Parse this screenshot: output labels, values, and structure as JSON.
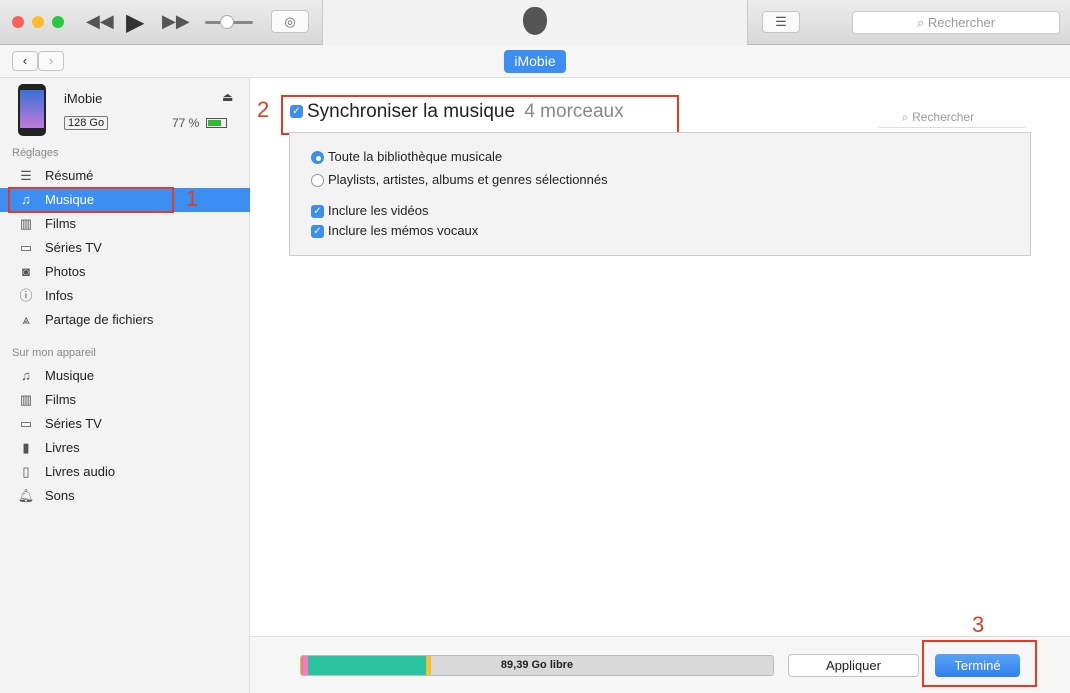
{
  "toolbar": {
    "search_placeholder": "Rechercher"
  },
  "device": {
    "badge": "iMobie",
    "name": "iMobie",
    "capacity": "128 Go",
    "battery": "77 %",
    "battery_level": 0.77
  },
  "sidebar": {
    "settings_title": "Réglages",
    "settings_items": [
      {
        "label": "Résumé",
        "icon": "list-icon"
      },
      {
        "label": "Musique",
        "icon": "music-note-icon"
      },
      {
        "label": "Films",
        "icon": "film-icon"
      },
      {
        "label": "Séries TV",
        "icon": "tv-icon"
      },
      {
        "label": "Photos",
        "icon": "camera-icon"
      },
      {
        "label": "Infos",
        "icon": "info-icon"
      },
      {
        "label": "Partage de fichiers",
        "icon": "apps-icon"
      }
    ],
    "device_title": "Sur mon appareil",
    "device_items": [
      {
        "label": "Musique",
        "icon": "music-note-icon"
      },
      {
        "label": "Films",
        "icon": "film-icon"
      },
      {
        "label": "Séries TV",
        "icon": "tv-icon"
      },
      {
        "label": "Livres",
        "icon": "book-icon"
      },
      {
        "label": "Livres audio",
        "icon": "audiobook-icon"
      },
      {
        "label": "Sons",
        "icon": "bell-icon"
      }
    ]
  },
  "main": {
    "sync_label": "Synchroniser la musique",
    "sync_count": "4 morceaux",
    "search_placeholder": "Rechercher",
    "options": [
      "Toute la bibliothèque musicale",
      "Playlists, artistes, albums et genres sélectionnés"
    ],
    "checks": [
      "Inclure les vidéos",
      "Inclure les mémos vocaux"
    ]
  },
  "annotations": [
    "1",
    "2",
    "3"
  ],
  "footer": {
    "free": "89,39 Go libre",
    "apply": "Appliquer",
    "done": "Terminé",
    "storage": [
      {
        "color": "#f08a3c",
        "pct": 0.5
      },
      {
        "color": "#f27ac8",
        "pct": 1
      },
      {
        "color": "#2ac3a0",
        "pct": 25
      },
      {
        "color": "#f2c12e",
        "pct": 1
      }
    ]
  },
  "colors": {
    "accent": "#3d8ef2",
    "annotation": "#e53a24"
  }
}
